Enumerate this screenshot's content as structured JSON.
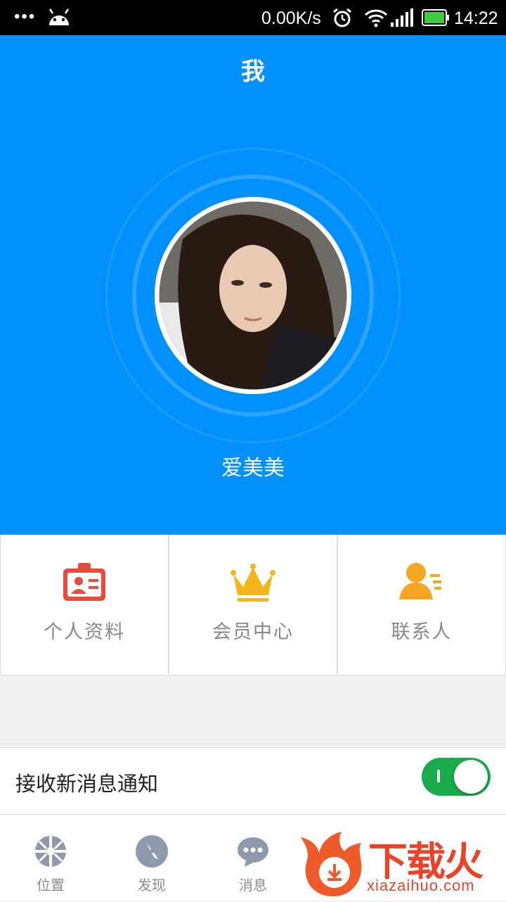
{
  "status_bar": {
    "dots": "•••",
    "net_speed": "0.00K/s",
    "time": "14:22",
    "icons": [
      "android-icon",
      "alarm-icon",
      "wifi-icon",
      "signal-icon",
      "battery-icon"
    ]
  },
  "header": {
    "title": "我"
  },
  "profile": {
    "username": "爱美美",
    "avatar": "user-avatar-photo"
  },
  "grid": [
    {
      "label": "个人资料",
      "icon": "id-card-icon",
      "color": "#e94b3c"
    },
    {
      "label": "会员中心",
      "icon": "crown-icon",
      "color": "#f5b51c"
    },
    {
      "label": "联系人",
      "icon": "contacts-icon",
      "color": "#f5a623"
    }
  ],
  "settings": {
    "notify_label": "接收新消息通知",
    "notify_enabled": true
  },
  "tabs": [
    {
      "label": "位置",
      "icon": "location-icon"
    },
    {
      "label": "发现",
      "icon": "compass-icon"
    },
    {
      "label": "消息",
      "icon": "message-icon"
    }
  ],
  "watermark": {
    "text": "下载火",
    "url": "xiazaihuo.com"
  },
  "colors": {
    "primary": "#0091ff",
    "toggle_on": "#1aab4c"
  }
}
